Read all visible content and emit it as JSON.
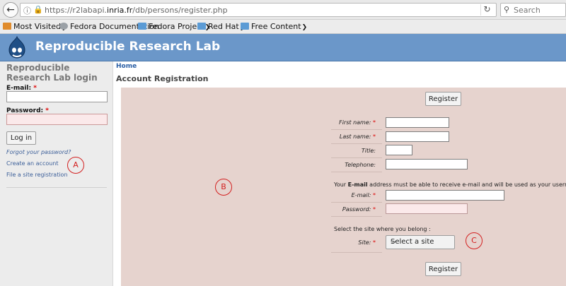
{
  "browser": {
    "url_prefix": "https://r2labapi.",
    "url_domain": "inria.fr",
    "url_path": "/db/persons/register.php",
    "search_placeholder": "Search",
    "bookmarks": [
      {
        "label": "Most Visited",
        "icon": "most-visited-icon"
      },
      {
        "label": "Fedora Documentation",
        "icon": "fedora-icon"
      },
      {
        "label": "Fedora Project",
        "icon": "folder-icon"
      },
      {
        "label": "Red Hat",
        "icon": "folder-icon"
      },
      {
        "label": "Free Content",
        "icon": "folder-icon"
      }
    ]
  },
  "site": {
    "title": "Reproducible Research Lab",
    "header_color": "#6b97c9"
  },
  "sidebar": {
    "title": "Reproducible Research Lab login",
    "email_label": "E-mail:",
    "password_label": "Password:",
    "login_button": "Log in",
    "links": [
      "Forgot your password?",
      "Create an account",
      "File a site registration"
    ]
  },
  "markers": {
    "a": "A",
    "b": "B",
    "c": "C"
  },
  "main": {
    "breadcrumb": "Home",
    "page_title": "Account Registration",
    "register_button": "Register",
    "first_name_label": "First name:",
    "last_name_label": "Last name:",
    "title_label": "Title:",
    "telephone_label": "Telephone:",
    "email_note_pre": "Your ",
    "email_note_bold": "E-mail",
    "email_note_post": " address must be able to receive e-mail and will be used as your username:",
    "email_label": "E-mail:",
    "password_label": "Password:",
    "site_note": "Select the site where you belong :",
    "site_label": "Site:",
    "site_select_value": "Select a site",
    "required_mark": "*"
  }
}
